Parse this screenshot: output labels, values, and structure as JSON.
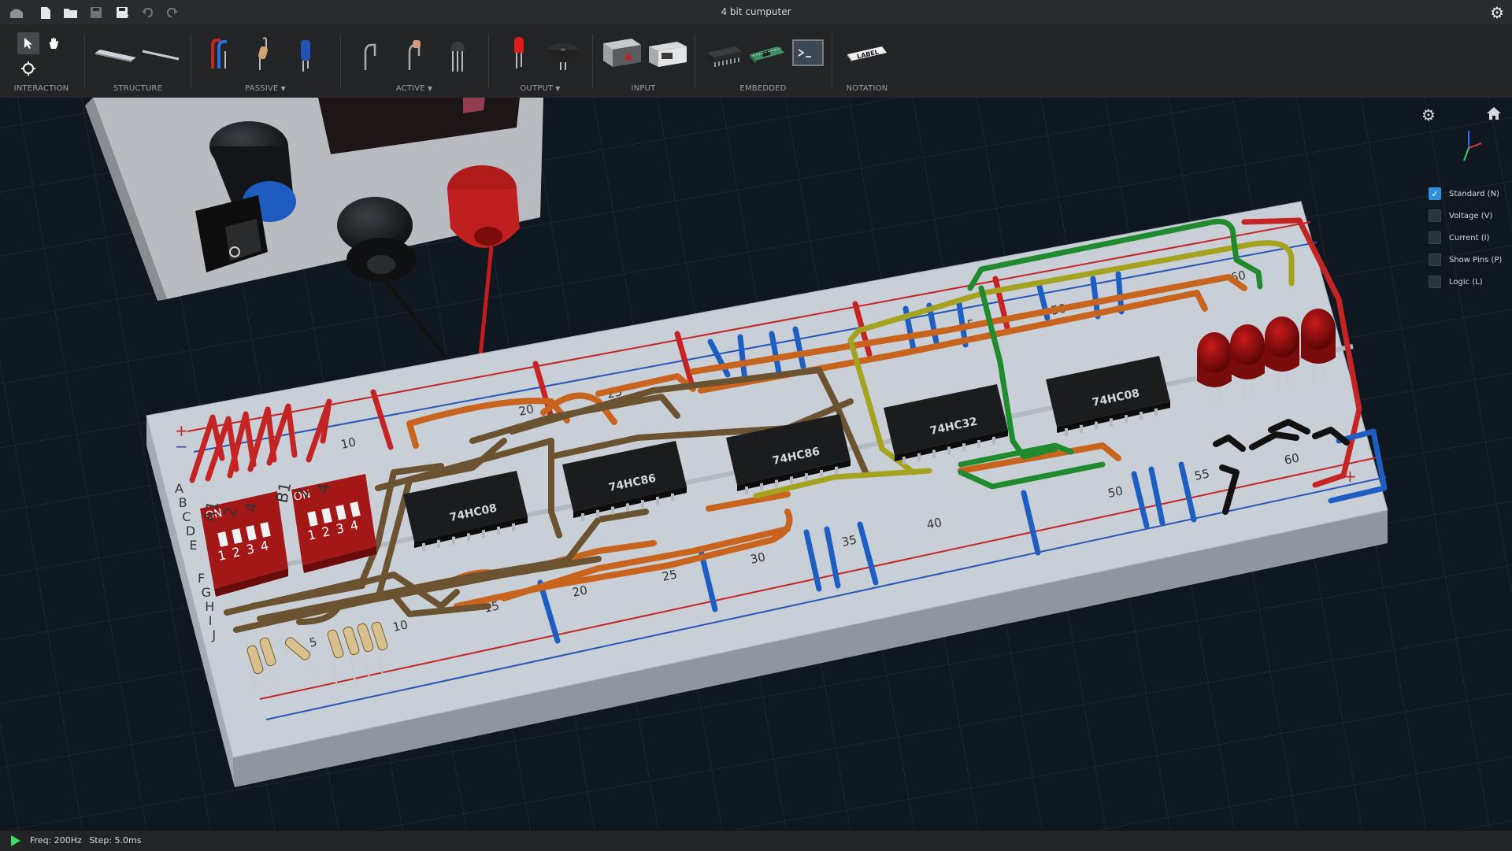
{
  "window": {
    "title": "4 bit cumputer"
  },
  "titlebar_icons": [
    "app-logo-icon",
    "new-file-icon",
    "open-folder-icon",
    "save-icon",
    "save-as-icon",
    "undo-icon",
    "redo-icon"
  ],
  "toolbar": {
    "groups": [
      {
        "id": "interaction",
        "label": "INTERACTION",
        "dropdown": false
      },
      {
        "id": "structure",
        "label": "STRUCTURE",
        "dropdown": false
      },
      {
        "id": "passive",
        "label": "PASSIVE",
        "dropdown": true
      },
      {
        "id": "active",
        "label": "ACTIVE",
        "dropdown": true
      },
      {
        "id": "output",
        "label": "OUTPUT",
        "dropdown": true
      },
      {
        "id": "input",
        "label": "INPUT",
        "dropdown": false
      },
      {
        "id": "embedded",
        "label": "EMBEDDED",
        "dropdown": false
      },
      {
        "id": "notation",
        "label": "NOTATION",
        "dropdown": false
      }
    ],
    "label_tool_text": "LABEL"
  },
  "view_options": [
    {
      "label": "Standard (N)",
      "checked": true
    },
    {
      "label": "Voltage (V)",
      "checked": false
    },
    {
      "label": "Current (I)",
      "checked": false
    },
    {
      "label": "Show Pins (P)",
      "checked": false
    },
    {
      "label": "Logic (L)",
      "checked": false
    }
  ],
  "breadboard": {
    "chips": [
      "74HC08",
      "74HC86",
      "74HC86",
      "74HC32",
      "74HC08"
    ],
    "dip_switch_a_labels": [
      "A1",
      "2",
      "4"
    ],
    "dip_switch_b_labels": [
      "B1",
      "2",
      "4"
    ],
    "dip_on_label": "ON",
    "dip_numbers": [
      "1",
      "2",
      "3",
      "4"
    ],
    "row_letters": [
      "A",
      "B",
      "C",
      "D",
      "E",
      "F",
      "G",
      "H",
      "I",
      "J"
    ],
    "column_numbers_top": [
      "10",
      "20",
      "25",
      "45",
      "50",
      "60"
    ],
    "column_numbers_bottom": [
      "5",
      "10",
      "15",
      "20",
      "25",
      "30",
      "35",
      "40",
      "50",
      "55",
      "60"
    ],
    "rail_plus": "+",
    "rail_minus": "−"
  },
  "status": {
    "freq": "Freq: 200Hz",
    "step": "Step: 5.0ms"
  },
  "colors": {
    "background": "#0f1721",
    "toolbar": "#232426",
    "breadboard": "#c9cfd6",
    "wire_orange": "#c8641e",
    "wire_brown": "#6b5231",
    "wire_green": "#1f8a2e",
    "wire_yellow": "#a4a21f",
    "wire_red": "#c42424",
    "wire_blue": "#1d5ec2",
    "led_red": "#8a0d0d",
    "play_green": "#3ddc68"
  }
}
